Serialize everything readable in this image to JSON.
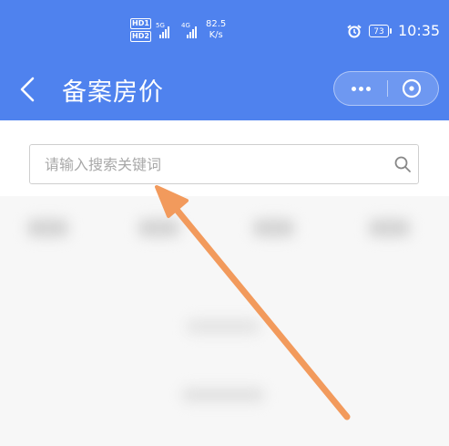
{
  "status_bar": {
    "hd1": "HD",
    "hd1_sim": "1",
    "hd2": "HD",
    "hd2_sim": "2",
    "network1": "5G",
    "network2": "4G",
    "speed_value": "82.5",
    "speed_unit": "K/s",
    "battery": "73",
    "time": "10:35"
  },
  "header": {
    "title": "备案房价"
  },
  "search": {
    "placeholder": "请输入搜索关键词"
  },
  "colors": {
    "header_bg": "#4f82ee",
    "arrow": "#f29a5c"
  }
}
